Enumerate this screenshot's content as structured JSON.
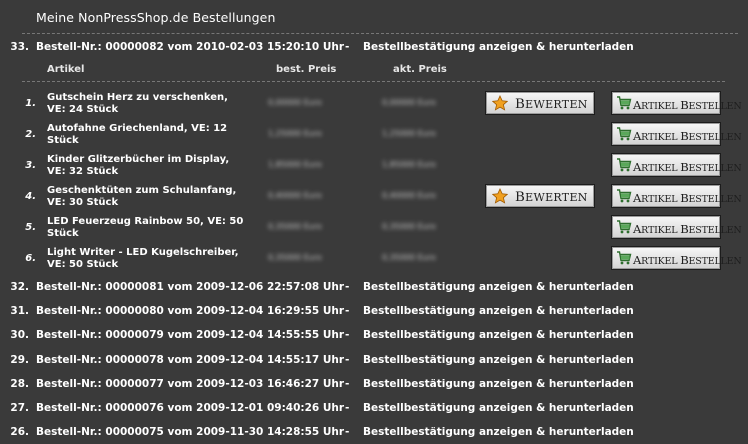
{
  "page": {
    "title": "Meine NonPressShop.de Bestellungen"
  },
  "expanded_order": {
    "number": "33.",
    "info": "Bestell-Nr.: 00000082 vom 2010-02-03 15:20:10 Uhr",
    "separator": "-",
    "link": "Bestellbestätigung anzeigen & herunterladen"
  },
  "columns": {
    "article": "Artikel",
    "best_price": "best. Preis",
    "current_price": "akt. Preis"
  },
  "items": [
    {
      "index": "1.",
      "name": "Gutschein Herz zu verschenken, VE: 24 Stück",
      "best_price": "0,00000 Euro",
      "current_price": "0,00000 Euro",
      "rate": true
    },
    {
      "index": "2.",
      "name": "Autofahne Griechenland, VE: 12 Stück",
      "best_price": "1,25000 Euro",
      "current_price": "1,25000 Euro",
      "rate": false
    },
    {
      "index": "3.",
      "name": "Kinder Glitzerbücher im Display, VE: 32 Stück",
      "best_price": "1,85000 Euro",
      "current_price": "1,85000 Euro",
      "rate": false
    },
    {
      "index": "4.",
      "name": "Geschenktüten zum Schulanfang, VE: 30 Stück",
      "best_price": "0,40000 Euro",
      "current_price": "0,40000 Euro",
      "rate": true
    },
    {
      "index": "5.",
      "name": "LED Feuerzeug Rainbow 50, VE: 50 Stück",
      "best_price": "0,35000 Euro",
      "current_price": "0,35000 Euro",
      "rate": false
    },
    {
      "index": "6.",
      "name": "Light Writer - LED Kugelschreiber, VE: 50 Stück",
      "best_price": "0,35000 Euro",
      "current_price": "0,35000 Euro",
      "rate": false
    }
  ],
  "buttons": {
    "rate_label": "Bewerten",
    "order_label": "Artikel bestellen"
  },
  "orders": [
    {
      "number": "32.",
      "info": "Bestell-Nr.: 00000081 vom 2009-12-06 22:57:08 Uhr",
      "separator": "-",
      "link": "Bestellbestätigung anzeigen & herunterladen"
    },
    {
      "number": "31.",
      "info": "Bestell-Nr.: 00000080 vom 2009-12-04 16:29:55 Uhr",
      "separator": "-",
      "link": "Bestellbestätigung anzeigen & herunterladen"
    },
    {
      "number": "30.",
      "info": "Bestell-Nr.: 00000079 vom 2009-12-04 14:55:55 Uhr",
      "separator": "-",
      "link": "Bestellbestätigung anzeigen & herunterladen"
    },
    {
      "number": "29.",
      "info": "Bestell-Nr.: 00000078 vom 2009-12-04 14:55:17 Uhr",
      "separator": "-",
      "link": "Bestellbestätigung anzeigen & herunterladen"
    },
    {
      "number": "28.",
      "info": "Bestell-Nr.: 00000077 vom 2009-12-03 16:46:27 Uhr",
      "separator": "-",
      "link": "Bestellbestätigung anzeigen & herunterladen"
    },
    {
      "number": "27.",
      "info": "Bestell-Nr.: 00000076 vom 2009-12-01 09:40:26 Uhr",
      "separator": "-",
      "link": "Bestellbestätigung anzeigen & herunterladen"
    },
    {
      "number": "26.",
      "info": "Bestell-Nr.: 00000075 vom 2009-11-30 14:28:55 Uhr",
      "separator": "-",
      "link": "Bestellbestätigung anzeigen & herunterladen"
    }
  ],
  "icons": {
    "rate": "star-icon",
    "order": "shopping-cart-icon"
  },
  "colors": {
    "background": "#3a3a3a",
    "text": "#ffffff",
    "star": "#f0a020",
    "cart": "#3a8a3a"
  }
}
